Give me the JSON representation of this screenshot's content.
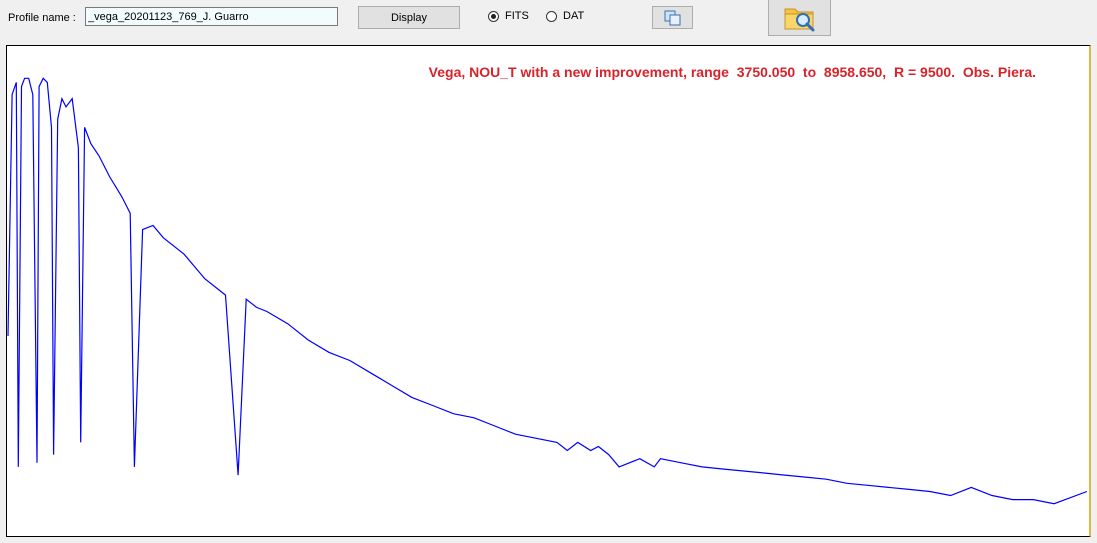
{
  "toolbar": {
    "profile_label": "Profile name :",
    "profile_value": "_vega_20201123_769_J. Guarro",
    "display_label": "Display",
    "format_options": [
      {
        "label": "FITS",
        "selected": true
      },
      {
        "label": "DAT",
        "selected": false
      }
    ],
    "copy_icon": "copy-icon",
    "open_icon": "folder-search-icon"
  },
  "plot": {
    "title": "Vega, NOU_T with a new improvement, range  3750.050  to  8958.650,  R = 9500.  Obs. Piera.",
    "line_color": "#0000ff",
    "title_color": "#d8232a"
  },
  "chart_data": {
    "type": "line",
    "title": "Vega, NOU_T with a new improvement, range  3750.050  to  8958.650,  R = 9500.  Obs. Piera.",
    "xlabel": "",
    "ylabel": "",
    "xlim": [
      3750.05,
      8958.65
    ],
    "grid": false,
    "series": [
      {
        "x": [
          3750,
          3770,
          3790,
          3800,
          3815,
          3830,
          3850,
          3870,
          3890,
          3900,
          3920,
          3940,
          3960,
          3970,
          3990,
          4010,
          4030,
          4060,
          4090,
          4101,
          4120,
          4150,
          4190,
          4240,
          4300,
          4340,
          4360,
          4400,
          4450,
          4500,
          4600,
          4700,
          4800,
          4861,
          4900,
          4950,
          5000,
          5100,
          5200,
          5300,
          5400,
          5500,
          5600,
          5700,
          5800,
          5900,
          6000,
          6100,
          6200,
          6300,
          6400,
          6450,
          6500,
          6563,
          6600,
          6650,
          6700,
          6800,
          6870,
          6900,
          7000,
          7100,
          7200,
          7300,
          7400,
          7500,
          7600,
          7700,
          7800,
          7900,
          8000,
          8100,
          8200,
          8300,
          8400,
          8500,
          8600,
          8700,
          8800,
          8958
        ],
        "y": [
          0.34,
          0.93,
          0.96,
          0.02,
          0.95,
          0.97,
          0.97,
          0.93,
          0.03,
          0.95,
          0.97,
          0.96,
          0.85,
          0.05,
          0.87,
          0.92,
          0.9,
          0.92,
          0.8,
          0.08,
          0.85,
          0.81,
          0.78,
          0.73,
          0.68,
          0.64,
          0.02,
          0.6,
          0.61,
          0.58,
          0.54,
          0.48,
          0.44,
          0.0,
          0.43,
          0.41,
          0.4,
          0.37,
          0.33,
          0.3,
          0.28,
          0.25,
          0.22,
          0.19,
          0.17,
          0.15,
          0.14,
          0.12,
          0.1,
          0.09,
          0.08,
          0.06,
          0.08,
          0.06,
          0.07,
          0.05,
          0.02,
          0.04,
          0.02,
          0.04,
          0.03,
          0.02,
          0.015,
          0.01,
          0.005,
          0.0,
          -0.005,
          -0.01,
          -0.02,
          -0.025,
          -0.03,
          -0.035,
          -0.04,
          -0.05,
          -0.03,
          -0.05,
          -0.06,
          -0.06,
          -0.07,
          -0.04
        ]
      }
    ]
  }
}
